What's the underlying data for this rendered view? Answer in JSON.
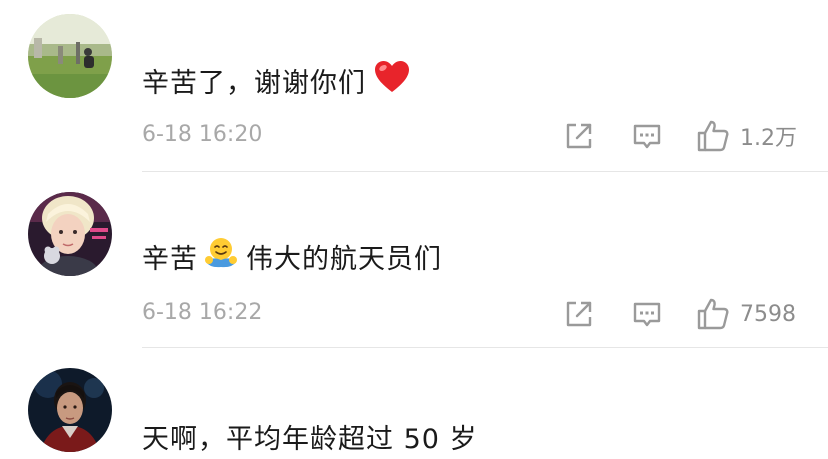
{
  "comments": [
    {
      "text": "辛苦了，谢谢你们",
      "emoji": "heart-icon",
      "time": "6-18 16:20",
      "likes": "1.2万"
    },
    {
      "text_before": "辛苦",
      "emoji": "hug-emoji-icon",
      "text_after": "伟大的航天员们",
      "time": "6-18 16:22",
      "likes": "7598"
    },
    {
      "text": "天啊，平均年龄超过 50 岁"
    }
  ],
  "colors": {
    "text": "#1a1a1a",
    "meta": "#a8a8a8",
    "icon": "#9a9a9a",
    "divider": "#e6e6e6",
    "heart": "#e8242b"
  }
}
